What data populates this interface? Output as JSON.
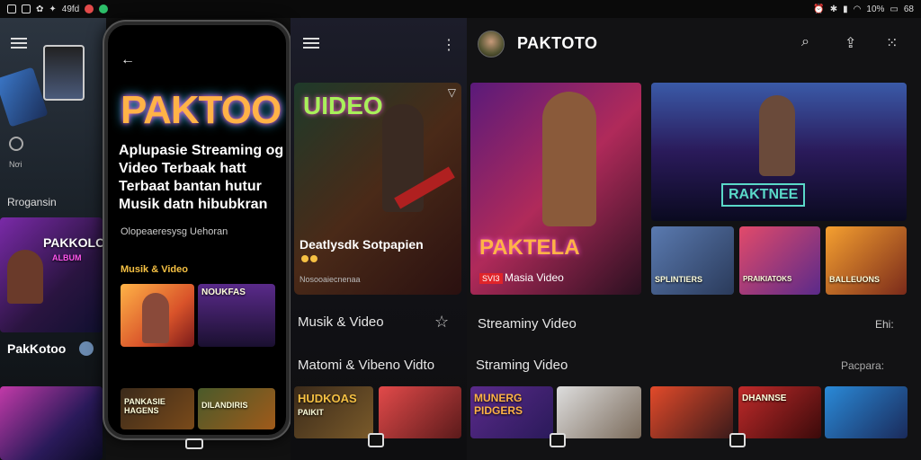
{
  "status_bar": {
    "left_text": "49fd",
    "right_text": "10%",
    "right_text2": "68"
  },
  "panel1": {
    "small_text": "Nơi",
    "section_label": "Rrogansin",
    "thumb_label": "PAKKOLO",
    "thumb_label2": "ALBUM",
    "channel_name": "PakKotoo"
  },
  "phone": {
    "logo": "PAKTOO",
    "tagline": "Aplupasie Streaming og Video Terbaak hatt Terbaat bantan hutur Musik datn hibubkran",
    "subtitle": "Olopeaeresysg Uehoran",
    "section": "Musik & Video",
    "thumb2_label": "NOUKFAS",
    "thumb3_label": "PANKASIE HAGENS",
    "thumb4_label": "DILANDIRIS"
  },
  "panel3": {
    "hero_title": "UIDEO",
    "hero_caption": "Deatlysdk Sotpapien",
    "hero_sub": "Nosooaiecnenaa",
    "row1": "Musik & Video",
    "row2": "Matomi & Vibeno Vidto",
    "thumb1_label": "HUDKOAS",
    "thumb1_sub": "PAIKIT"
  },
  "panel4": {
    "brand": "PAKTOTO",
    "hero_logo": "PAKTELA",
    "hero_badge": "SVI3",
    "hero_caption": "Masia Video",
    "card2_banner": "RAKTNEE",
    "mini1_label": "SPLINTIERS",
    "mini2_label": "PRAIKIATOKS",
    "mini3_label": "BALLEUONS",
    "row1_title": "Streaminy Video",
    "row1_action": "Ehi:",
    "row2_title": "Straming Video",
    "row2_action": "Pacpara:",
    "bottom1_label": "MUNERG PIDGERS",
    "bottom2_label": "DHANNSE"
  }
}
